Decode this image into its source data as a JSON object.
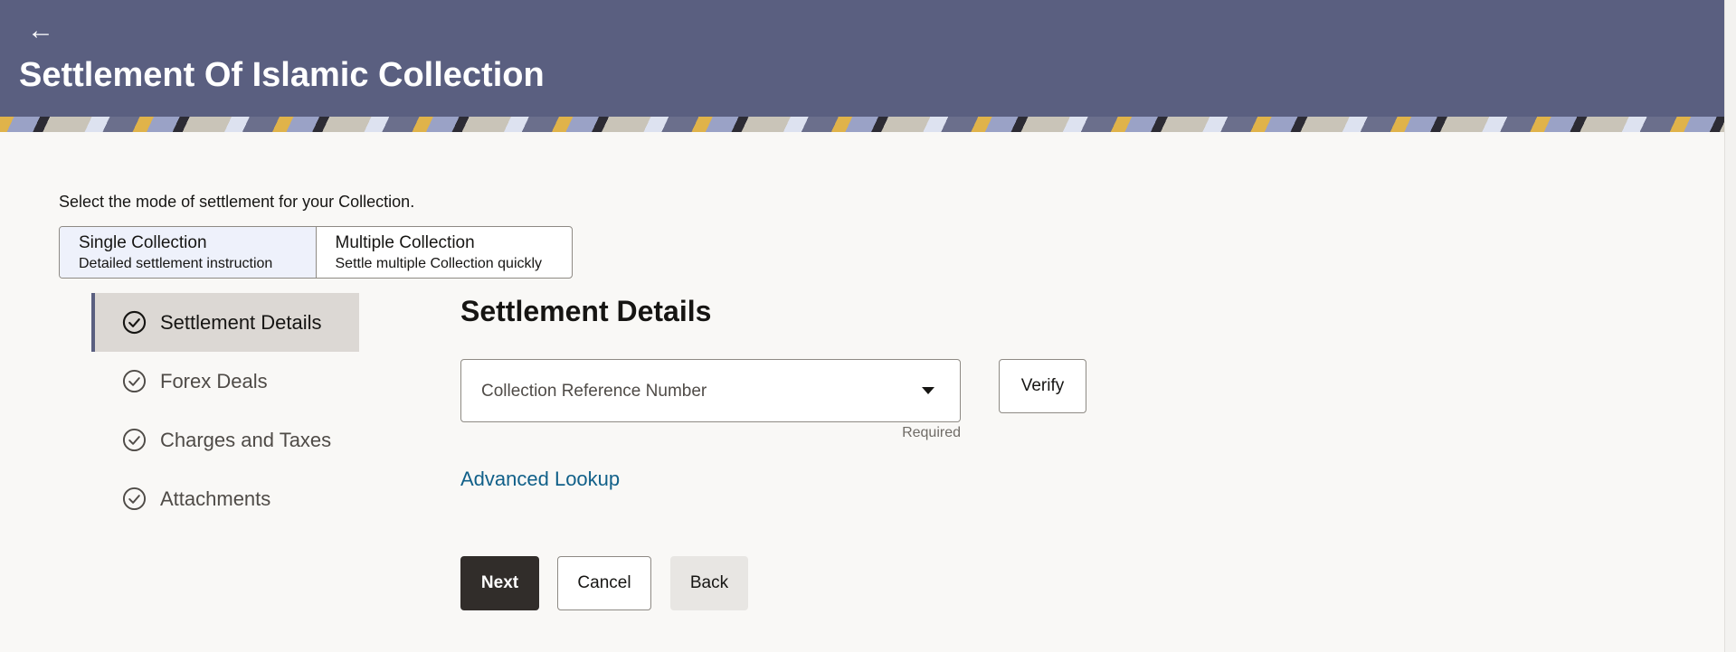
{
  "header": {
    "back_icon": "back-arrow-icon",
    "back_glyph": "←",
    "title": "Settlement Of Islamic Collection",
    "colors": {
      "background": "#5a5f80",
      "text": "#ffffff"
    }
  },
  "mode_selection": {
    "prompt": "Select the mode of settlement for your Collection.",
    "options": [
      {
        "title": "Single Collection",
        "subtitle": "Detailed settlement instruction",
        "selected": true
      },
      {
        "title": "Multiple Collection",
        "subtitle": "Settle multiple Collection quickly",
        "selected": false
      }
    ]
  },
  "steps": [
    {
      "label": "Settlement Details",
      "active": true,
      "icon": "check-circle-icon"
    },
    {
      "label": "Forex Deals",
      "active": false,
      "icon": "check-circle-icon"
    },
    {
      "label": "Charges and Taxes",
      "active": false,
      "icon": "check-circle-icon"
    },
    {
      "label": "Attachments",
      "active": false,
      "icon": "check-circle-icon"
    }
  ],
  "main": {
    "section_title": "Settlement Details",
    "collection_ref": {
      "placeholder": "Collection Reference Number",
      "required_text": "Required",
      "caret_icon": "caret-down-icon"
    },
    "verify_label": "Verify",
    "advanced_lookup_label": "Advanced Lookup",
    "link_color": "#116089"
  },
  "actions": {
    "next_label": "Next",
    "cancel_label": "Cancel",
    "back_label": "Back",
    "primary_color": "#312d2a"
  }
}
